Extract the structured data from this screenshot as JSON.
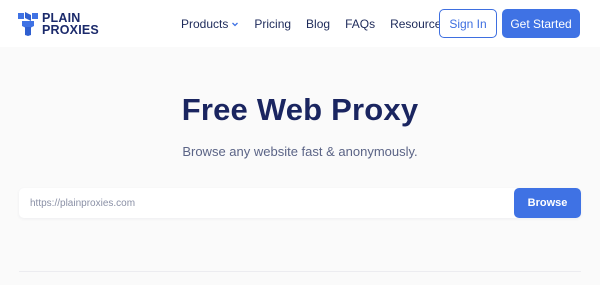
{
  "brand": {
    "line1": "PLAIN",
    "line2": "PROXIES",
    "icon": "plainproxies-logo-icon",
    "color": "#1b2a6b"
  },
  "nav": {
    "items": [
      {
        "label": "Products",
        "has_dropdown": true
      },
      {
        "label": "Pricing",
        "has_dropdown": false
      },
      {
        "label": "Blog",
        "has_dropdown": false
      },
      {
        "label": "FAQs",
        "has_dropdown": false
      },
      {
        "label": "Resources",
        "has_dropdown": true
      }
    ]
  },
  "header": {
    "signin_label": "Sign In",
    "get_started_label": "Get Started"
  },
  "hero": {
    "title": "Free Web Proxy",
    "subtitle": "Browse any website fast & anonymously."
  },
  "search": {
    "placeholder": "https://plainproxies.com",
    "value": "",
    "button_label": "Browse"
  },
  "colors": {
    "accent": "#3f72e4",
    "heading": "#1a2560",
    "background": "#fafafa"
  }
}
